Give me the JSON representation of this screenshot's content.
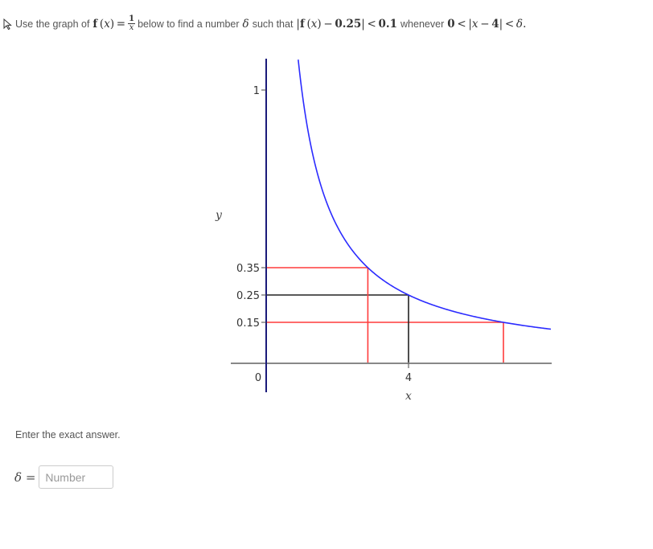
{
  "prompt": {
    "lead": "Use the graph of",
    "func_name": "f",
    "func_arg": "x",
    "frac_num": "1",
    "frac_den": "x",
    "mid": "below to find a number",
    "delta": "δ",
    "such_that": "such that",
    "condition_target": "0.25",
    "condition_eps": "0.1",
    "whenever": "whenever",
    "zero": "0",
    "center": "4"
  },
  "instructions": "Enter the exact answer.",
  "answer": {
    "label_symbol": "δ",
    "label_eq": "=",
    "placeholder": "Number",
    "value": ""
  },
  "colors": {
    "curve": "#2b2bff",
    "red_guides": "#ff3b3b",
    "black_guides": "#222222",
    "y_axis": "#1a1a7a",
    "x_axis": "#888888"
  },
  "chart_data": {
    "type": "line",
    "title": "",
    "function": "f(x) = 1/x",
    "xlabel": "x",
    "ylabel": "y",
    "xlim": [
      -1,
      8.0
    ],
    "ylim": [
      -0.1,
      1.12
    ],
    "grid": false,
    "x_ticks": [
      {
        "value": 0,
        "label": "0"
      },
      {
        "value": 4,
        "label": "4"
      }
    ],
    "y_ticks": [
      {
        "value": 1,
        "label": "1"
      },
      {
        "value": 0.35,
        "label": "0.35"
      },
      {
        "value": 0.25,
        "label": "0.25"
      },
      {
        "value": 0.15,
        "label": "0.15"
      }
    ],
    "series": [
      {
        "name": "f(x) = 1/x",
        "x_start": 0.9,
        "x_end": 8.0,
        "color": "#2b2bff"
      }
    ],
    "guides": [
      {
        "name": "y-0.35",
        "kind": "horizontal",
        "y": 0.35,
        "x_from": 0,
        "x_to": 2.857,
        "color": "#ff3b3b"
      },
      {
        "name": "y-0.25",
        "kind": "horizontal",
        "y": 0.25,
        "x_from": 0,
        "x_to": 4,
        "color": "#222222"
      },
      {
        "name": "y-0.15",
        "kind": "horizontal",
        "y": 0.15,
        "x_from": 0,
        "x_to": 6.667,
        "color": "#ff3b3b"
      },
      {
        "name": "x-2.857",
        "kind": "vertical",
        "x": 2.857,
        "y_from": 0,
        "y_to": 0.35,
        "color": "#ff3b3b"
      },
      {
        "name": "x-4",
        "kind": "vertical",
        "x": 4,
        "y_from": 0,
        "y_to": 0.25,
        "color": "#222222"
      },
      {
        "name": "x-6.667",
        "kind": "vertical",
        "x": 6.667,
        "y_from": 0,
        "y_to": 0.15,
        "color": "#ff3b3b"
      }
    ]
  }
}
